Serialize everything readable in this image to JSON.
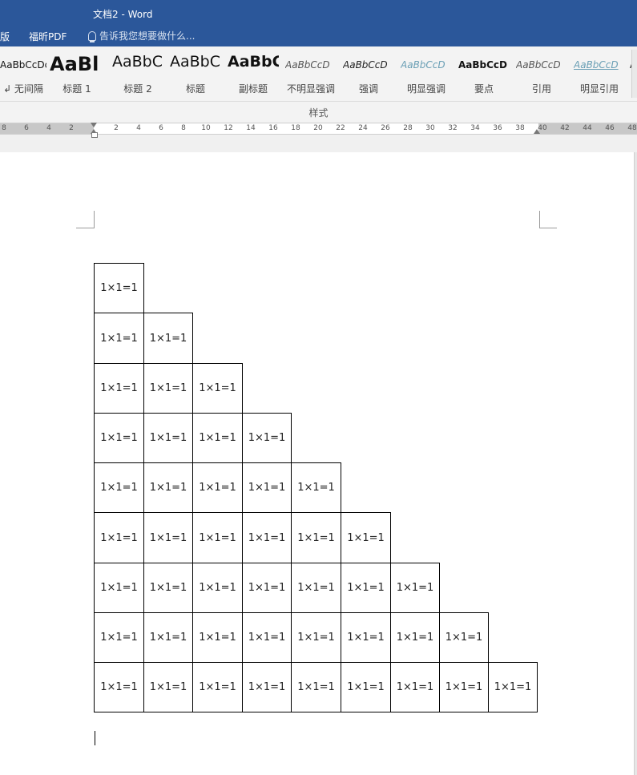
{
  "window": {
    "title": "文档2 - Word",
    "menu": [
      "版",
      "福昕PDF"
    ],
    "tell_me": "告诉我您想要做什么..."
  },
  "ribbon": {
    "group_label": "样式",
    "styles": [
      {
        "sample": "AaBbCcDc",
        "label": "↲ 无间隔"
      },
      {
        "sample": "AaBl",
        "label": "标题 1"
      },
      {
        "sample": "AaBbC",
        "label": "标题 2"
      },
      {
        "sample": "AaBbC",
        "label": "标题"
      },
      {
        "sample": "AaBbC",
        "label": "副标题"
      },
      {
        "sample": "AaBbCcD",
        "label": "不明显强调"
      },
      {
        "sample": "AaBbCcD",
        "label": "强调"
      },
      {
        "sample": "AaBbCcD",
        "label": "明显强调"
      },
      {
        "sample": "AaBbCcD",
        "label": "要点"
      },
      {
        "sample": "AaBbCcD",
        "label": "引用"
      },
      {
        "sample": "AaBbCcD",
        "label": "明显引用"
      },
      {
        "sample": "A",
        "label": "不"
      }
    ]
  },
  "ruler": {
    "ticks": [
      "8",
      "6",
      "4",
      "2",
      "2",
      "4",
      "6",
      "8",
      "10",
      "12",
      "14",
      "16",
      "18",
      "20",
      "22",
      "24",
      "26",
      "28",
      "30",
      "32",
      "34",
      "36",
      "38",
      "40",
      "42",
      "44",
      "46",
      "48"
    ]
  },
  "document": {
    "table": [
      [
        "1×1=1"
      ],
      [
        "1×1=1",
        "1×1=1"
      ],
      [
        "1×1=1",
        "1×1=1",
        "1×1=1"
      ],
      [
        "1×1=1",
        "1×1=1",
        "1×1=1",
        "1×1=1"
      ],
      [
        "1×1=1",
        "1×1=1",
        "1×1=1",
        "1×1=1",
        "1×1=1"
      ],
      [
        "1×1=1",
        "1×1=1",
        "1×1=1",
        "1×1=1",
        "1×1=1",
        "1×1=1"
      ],
      [
        "1×1=1",
        "1×1=1",
        "1×1=1",
        "1×1=1",
        "1×1=1",
        "1×1=1",
        "1×1=1"
      ],
      [
        "1×1=1",
        "1×1=1",
        "1×1=1",
        "1×1=1",
        "1×1=1",
        "1×1=1",
        "1×1=1",
        "1×1=1"
      ],
      [
        "1×1=1",
        "1×1=1",
        "1×1=1",
        "1×1=1",
        "1×1=1",
        "1×1=1",
        "1×1=1",
        "1×1=1",
        "1×1=1"
      ]
    ]
  }
}
